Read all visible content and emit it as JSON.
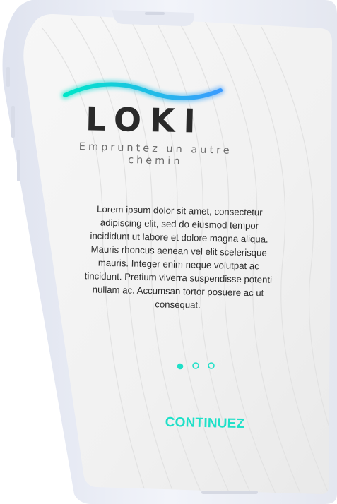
{
  "app": {
    "logo_text": "LOKI",
    "tagline": "Empruntez un autre chemin"
  },
  "onboarding": {
    "body": "Lorem ipsum dolor sit amet, consectetur adipiscing elit, sed do eiusmod tempor incididunt ut labore et dolore magna aliqua. Mauris rhoncus aenean vel elit scelerisque mauris. Integer enim neque volutpat ac tincidunt. Pretium viverra suspendisse potenti nullam ac. Accumsan tortor posuere ac ut consequat.",
    "pages_total": 3,
    "page_active": 1,
    "continue_label": "CONTINUEZ"
  },
  "colors": {
    "accent": "#1fe0c8",
    "wave_gradient_start": "#00e6c8",
    "wave_gradient_end": "#3a9bff",
    "logo": "#2a2a2a",
    "screen_bg": "#f3f3f3",
    "frame": "#eceef5"
  }
}
